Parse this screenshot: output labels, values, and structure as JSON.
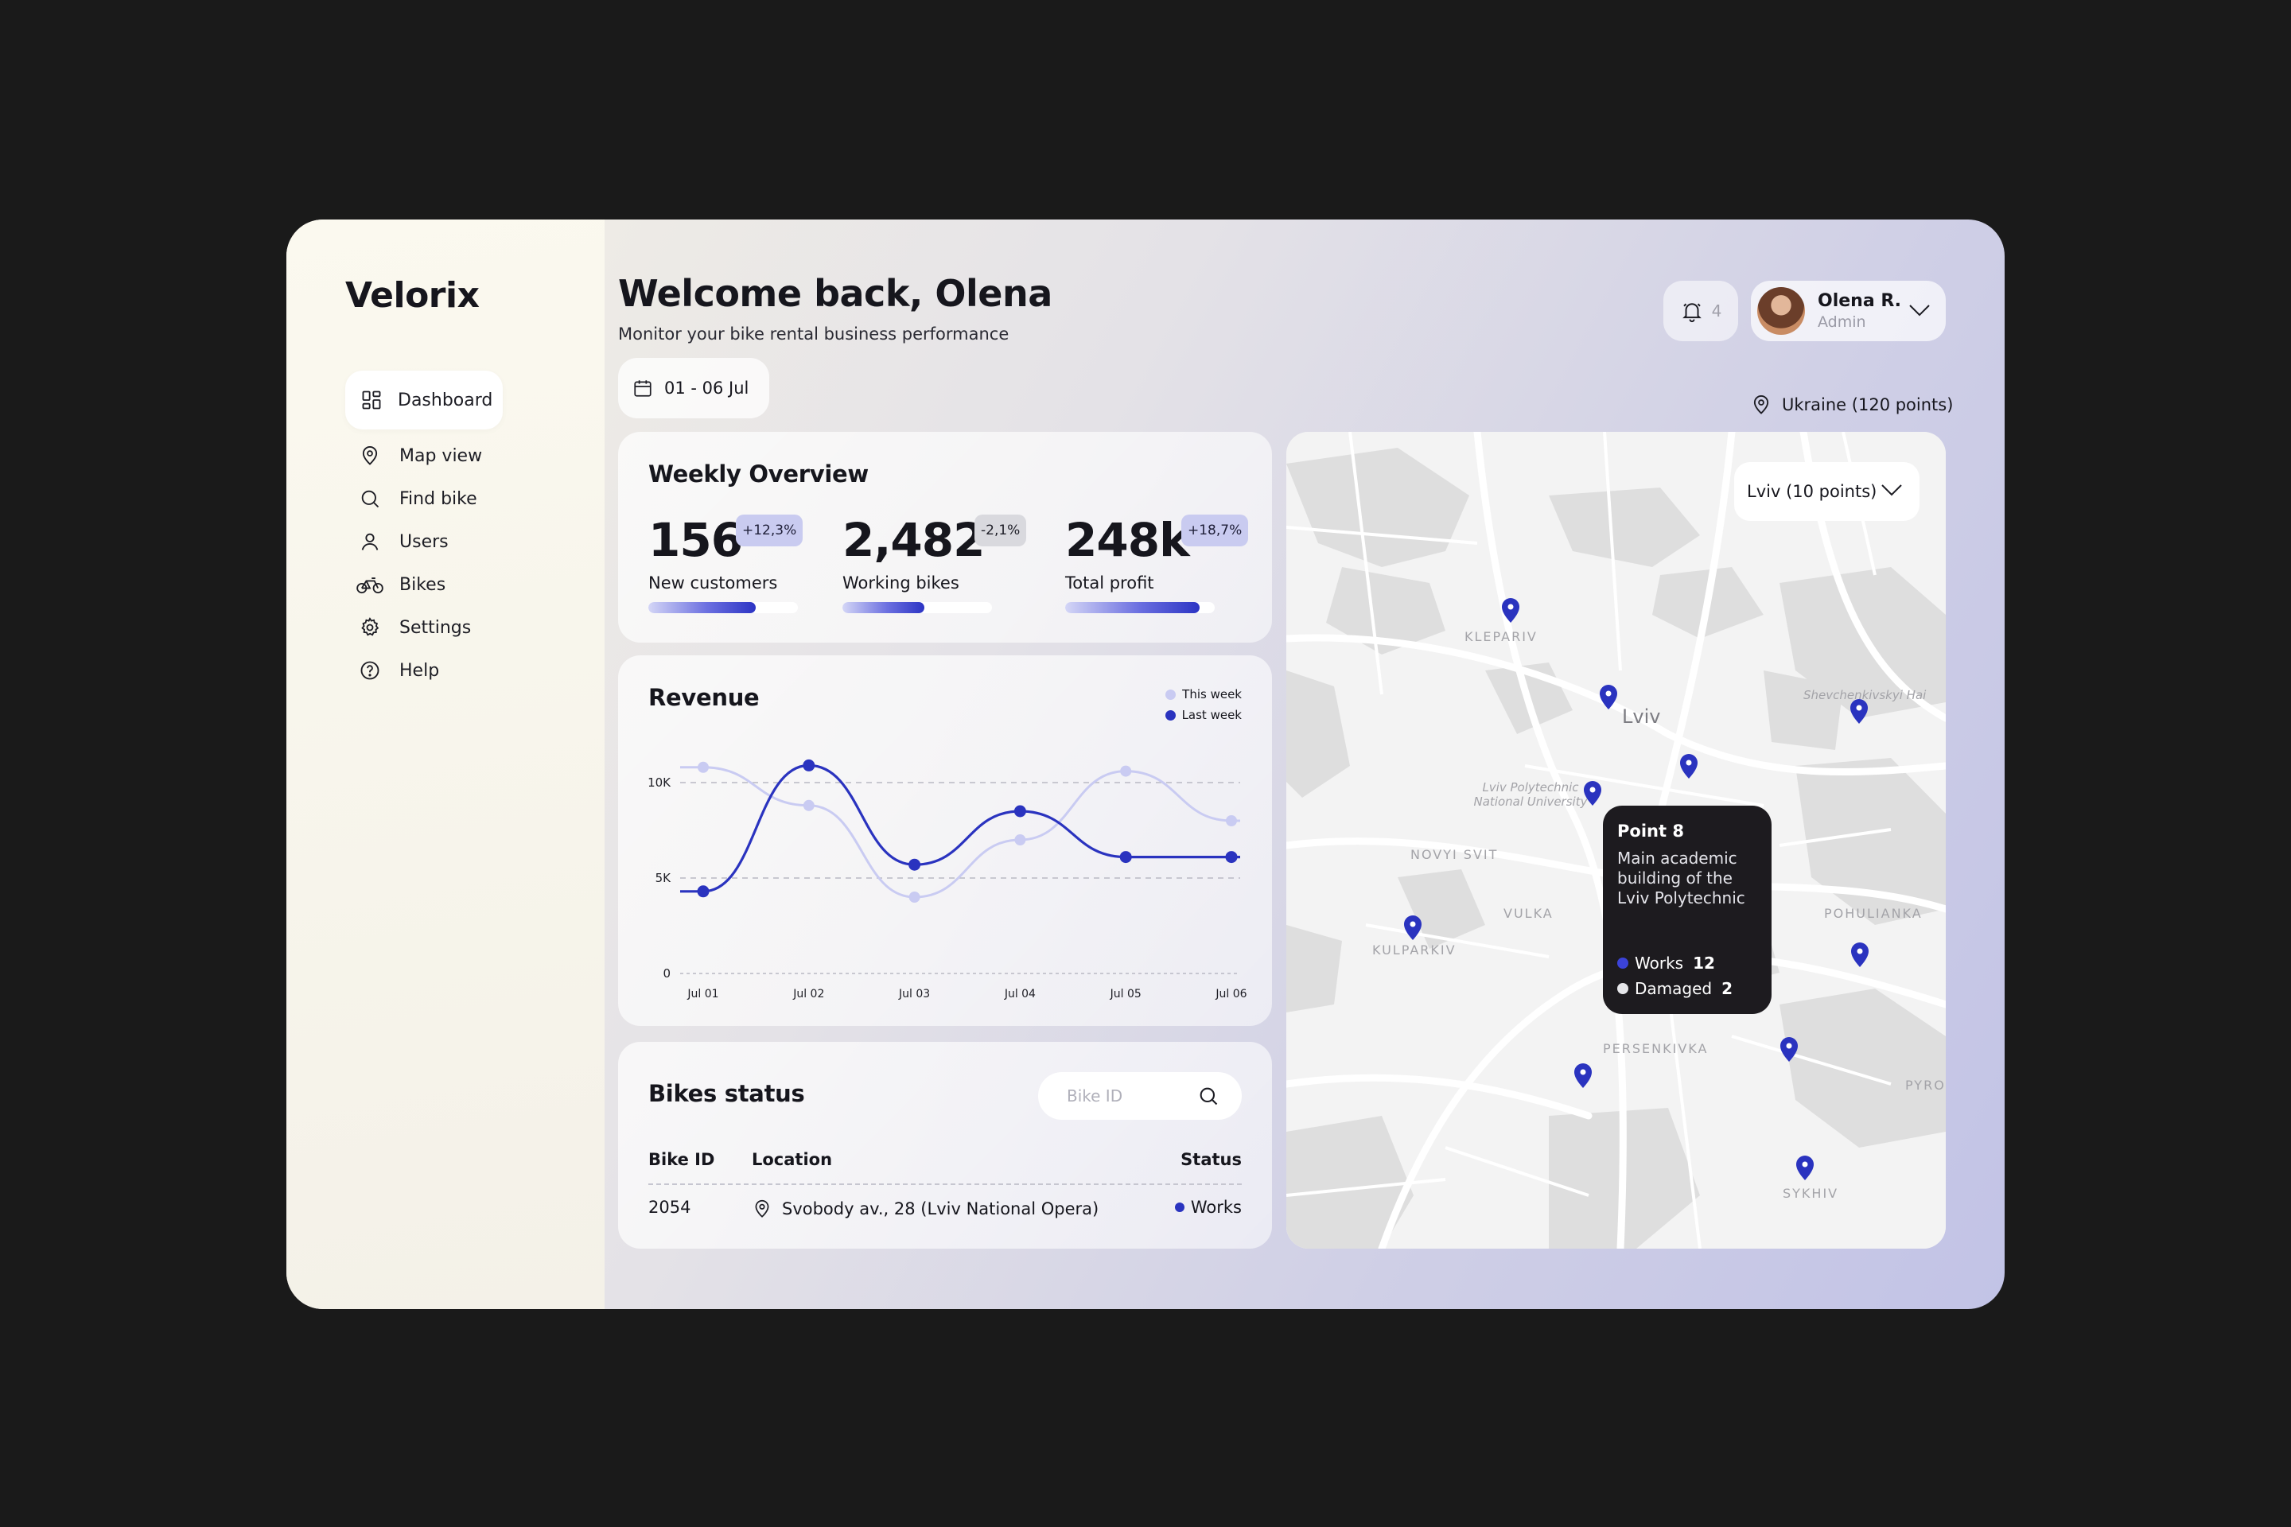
{
  "app": {
    "brand": "Velorix"
  },
  "sidebar": {
    "items": [
      {
        "label": "Dashboard",
        "icon": "dashboard-icon",
        "active": true
      },
      {
        "label": "Map view",
        "icon": "map-pin-icon"
      },
      {
        "label": "Find bike",
        "icon": "search-icon"
      },
      {
        "label": "Users",
        "icon": "user-icon"
      },
      {
        "label": "Bikes",
        "icon": "bike-icon"
      },
      {
        "label": "Settings",
        "icon": "gear-icon"
      },
      {
        "label": "Help",
        "icon": "help-icon"
      }
    ]
  },
  "header": {
    "title": "Welcome back, Olena",
    "subtitle": "Monitor your bike rental business performance",
    "date_range": "01 - 06 Jul",
    "notifications": "4",
    "user": {
      "name": "Olena R.",
      "role": "Admin"
    },
    "region": "Ukraine (120 points)"
  },
  "weekly": {
    "title": "Weekly Overview",
    "stats": [
      {
        "value": "156",
        "delta": "+12,3%",
        "trend": "up",
        "label": "New customers",
        "progress": 0.72
      },
      {
        "value": "2,482",
        "delta": "-2,1%",
        "trend": "down",
        "label": "Working bikes",
        "progress": 0.55
      },
      {
        "value": "248k",
        "delta": "+18,7%",
        "trend": "up",
        "label": "Total profit",
        "progress": 0.9
      }
    ]
  },
  "revenue": {
    "title": "Revenue",
    "legend": {
      "this_week": "This week",
      "last_week": "Last week"
    }
  },
  "chart_data": {
    "type": "line",
    "title": "Revenue",
    "categories": [
      "Jul 01",
      "Jul 02",
      "Jul 03",
      "Jul 04",
      "Jul 05",
      "Jul 06"
    ],
    "y_ticks": [
      "0",
      "5K",
      "10K"
    ],
    "ylim": [
      0,
      12000
    ],
    "grid": true,
    "legend_position": "top-right",
    "series": [
      {
        "name": "This week",
        "color": "#c9cbf2",
        "values": [
          10800,
          8800,
          4000,
          7000,
          10600,
          8000
        ]
      },
      {
        "name": "Last week",
        "color": "#2a33bf",
        "values": [
          4300,
          10900,
          5700,
          8500,
          6100,
          6100
        ]
      }
    ]
  },
  "bikes": {
    "title": "Bikes status",
    "search_placeholder": "Bike ID",
    "columns": {
      "id": "Bike ID",
      "location": "Location",
      "status": "Status"
    },
    "rows": [
      {
        "id": "2054",
        "location": "Svobody av., 28 (Lviv National Opera)",
        "status": "Works"
      }
    ]
  },
  "map": {
    "dropdown": "Lviv (10 points)",
    "labels": {
      "city": "Lviv",
      "klepariv": "KLEPARIV",
      "shevchenkivskyi": "Shevchenkivskyi Hai",
      "polytechnic": "Lviv Polytechnic National University",
      "novyi_svit": "NOVYI SVIT",
      "vulka": "VULKA",
      "kulparkiv": "KULPARKIV",
      "pohulianka": "POHULIANKA",
      "persenkivka": "PERSENKIVKA",
      "pyro": "PYRO",
      "sykhiv": "SYKHIV"
    },
    "tooltip": {
      "title": "Point 8",
      "description": "Main academic building of the Lviv Polytechnic",
      "works_label": "Works",
      "works_count": "12",
      "damaged_label": "Damaged",
      "damaged_count": "2"
    }
  },
  "colors": {
    "accent": "#2a33bf",
    "accent_light": "#c9cbf2",
    "dark": "#1d1b1f"
  }
}
